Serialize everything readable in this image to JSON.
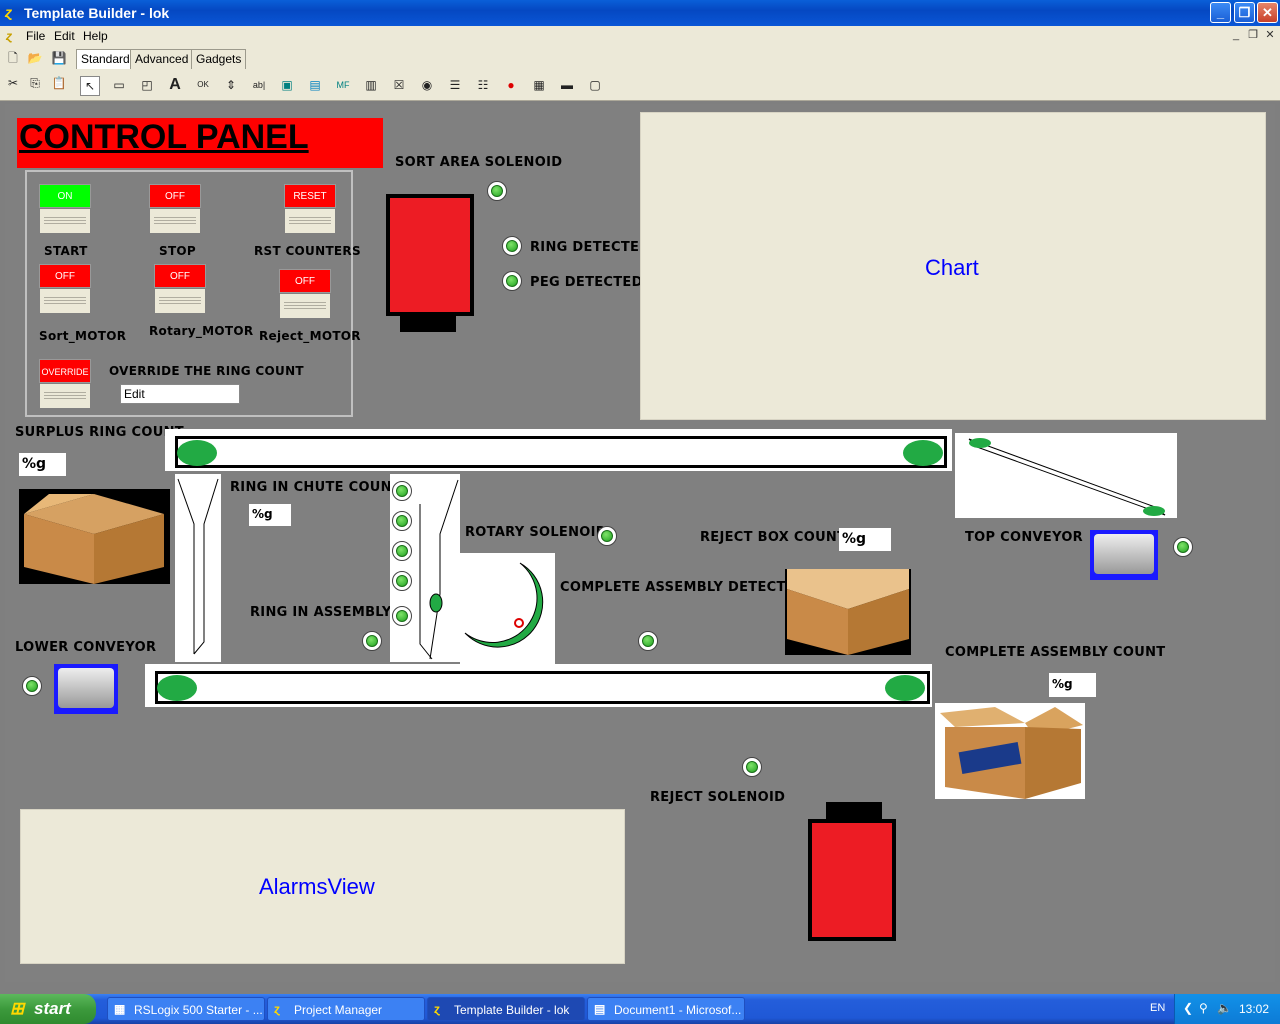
{
  "window": {
    "title": "Template Builder - lok",
    "min": "_",
    "max": "❐",
    "close": "✕"
  },
  "menu": {
    "file": "File",
    "edit": "Edit",
    "help": "Help"
  },
  "tabs": {
    "standard": "Standard",
    "advanced": "Advanced",
    "gadgets": "Gadgets"
  },
  "control_panel": {
    "title": "CONTROL PANEL",
    "buttons": {
      "start": {
        "state": "ON",
        "label": "START"
      },
      "stop": {
        "state": "OFF",
        "label": "STOP"
      },
      "reset": {
        "state": "RESET",
        "label": "RST COUNTERS"
      },
      "sort_motor": {
        "state": "OFF",
        "label": "Sort_MOTOR"
      },
      "rotary_motor": {
        "state": "OFF",
        "label": "Rotary_MOTOR"
      },
      "reject_motor": {
        "state": "OFF",
        "label": "Reject_MOTOR"
      },
      "override": {
        "state": "OVERRIDE",
        "label": "OVERRIDE THE RING COUNT"
      }
    },
    "override_field": "Edit"
  },
  "labels": {
    "sort_area_solenoid": "SORT AREA SOLENOID",
    "ring_detected": "RING DETECTED",
    "peg_detected": "PEG DETECTED",
    "chart": "Chart",
    "surplus_ring_count": "SURPLUS RING COUNT",
    "ring_in_chute_count": "RING IN CHUTE COUNT",
    "rotary_solenoid": "ROTARY SOLENOID",
    "reject_box_count": "REJECT BOX COUNT",
    "top_conveyor": "TOP CONVEYOR",
    "complete_assembly_detected": "COMPLETE ASSEMBLY DETECTED",
    "ring_in_assembly": "RING IN ASSEMBLY",
    "lower_conveyor": "LOWER CONVEYOR",
    "complete_assembly_count": "COMPLETE ASSEMBLY COUNT",
    "reject_solenoid": "REJECT SOLENOID",
    "alarms_view": "AlarmsView"
  },
  "values": {
    "surplus": "%g",
    "chute": "%g",
    "reject_box": "%g",
    "complete_assembly": "%g"
  },
  "colors": {
    "on": "#00ff00",
    "off": "#ff0000",
    "indicator": "#22aa44",
    "solenoid": "#ed1c24"
  },
  "taskbar": {
    "start": "start",
    "tasks": [
      "RSLogix 500 Starter - ...",
      "Project Manager",
      "Template Builder - lok",
      "Document1 - Microsof..."
    ],
    "lang": "EN",
    "clock": "13:02"
  }
}
